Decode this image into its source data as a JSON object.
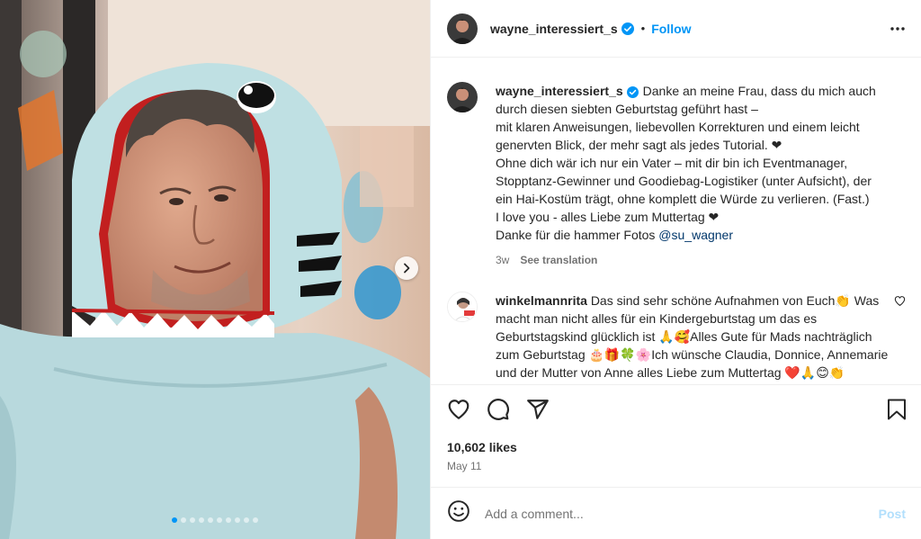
{
  "post": {
    "username": "wayne_interessiert_s",
    "verified": true,
    "follow_label": "Follow",
    "bullet": "•",
    "more_icon": "more-horizontal-icon"
  },
  "carousel": {
    "slide_count": 10,
    "active_index": 0,
    "next_icon": "chevron-right-icon"
  },
  "caption": {
    "username": "wayne_interessiert_s",
    "lines": [
      "Danke an meine Frau, dass du mich auch durch diesen siebten Geburtstag geführt hast –",
      "mit klaren Anweisungen, liebevollen Korrekturen und einem leicht genervten Blick, der mehr sagt als jedes Tutorial. ❤",
      "Ohne dich wär ich nur ein Vater – mit dir bin ich Eventmanager, Stopptanz-Gewinner und Goodiebag-Logistiker (unter Aufsicht), der ein Hai-Kostüm trägt, ohne komplett die Würde zu verlieren. (Fast.)",
      "I love you - alles Liebe zum Muttertag ❤"
    ],
    "photo_credit_prefix": "Danke für die hammer Fotos ",
    "photo_credit_mention": "@su_wagner",
    "age": "3w",
    "see_translation": "See translation"
  },
  "comments": [
    {
      "username": "winkelmannrita",
      "text": "Das sind sehr schöne Aufnahmen von Euch👏 Was macht man nicht alles für ein Kindergeburtstag um das es Geburtstagskind glücklich ist 🙏🥰Alles Gute für Mads nachträglich zum Geburtstag 🎂🎁🍀🌸Ich wünsche Claudia, Donnice, Annemarie und der Mutter von Anne alles Liebe zum Muttertag ❤️🙏😊👏"
    }
  ],
  "actions": {
    "like_icon": "heart-icon",
    "comment_icon": "comment-icon",
    "share_icon": "share-icon",
    "save_icon": "bookmark-icon",
    "likes": "10,602 likes",
    "date": "May 11"
  },
  "add_comment": {
    "emoji_icon": "emoji-icon",
    "placeholder": "Add a comment...",
    "post_label": "Post"
  },
  "colors": {
    "accent": "#0095f6",
    "text": "#262626",
    "secondary": "#737373",
    "heart": "#ed4956",
    "post_disabled": "#b2dffc"
  }
}
